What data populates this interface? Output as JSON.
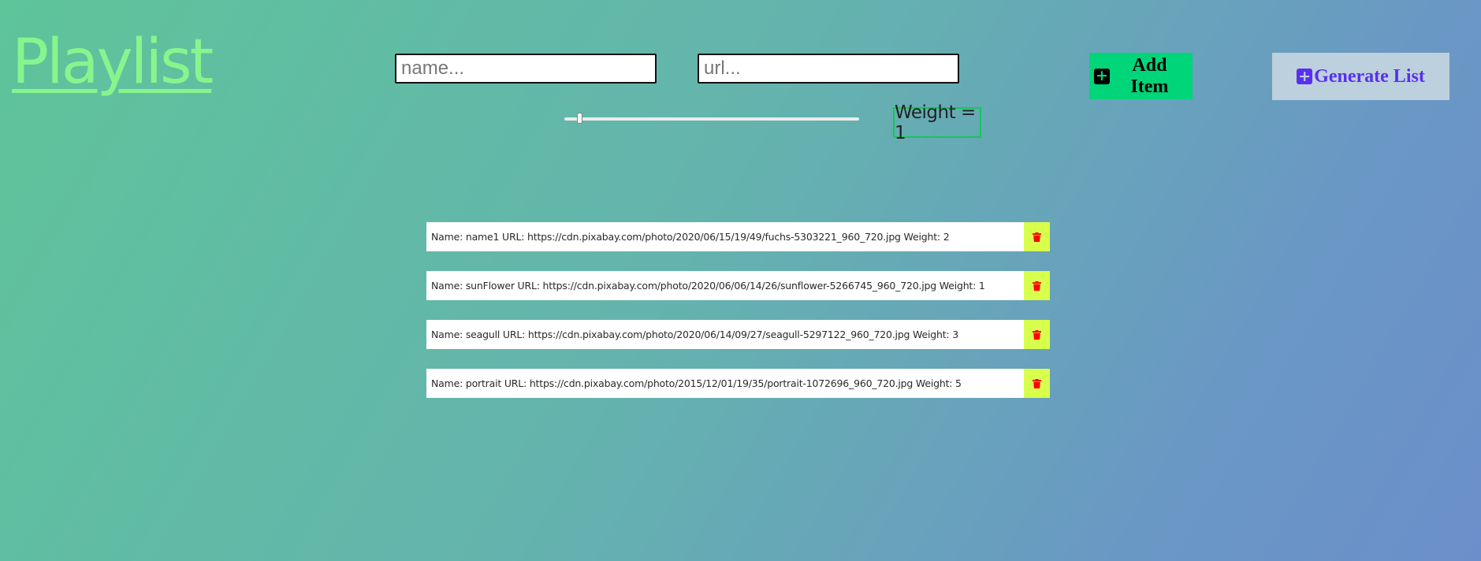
{
  "header": {
    "title": "Playlist"
  },
  "form": {
    "name_placeholder": "name...",
    "url_placeholder": "url...",
    "add_label": "Add Item",
    "generate_label": "Generate List",
    "weight_text": "Weight = 1",
    "weight_value": 1,
    "weight_slider_fraction": 0.05
  },
  "items": [
    {
      "text": "Name: name1 URL: https://cdn.pixabay.com/photo/2020/06/15/19/49/fuchs-5303221_960_720.jpg Weight: 2"
    },
    {
      "text": "Name: sunFlower URL: https://cdn.pixabay.com/photo/2020/06/06/14/26/sunflower-5266745_960_720.jpg Weight: 1"
    },
    {
      "text": "Name: seagull URL: https://cdn.pixabay.com/photo/2020/06/14/09/27/seagull-5297122_960_720.jpg Weight: 3"
    },
    {
      "text": "Name: portrait URL: https://cdn.pixabay.com/photo/2015/12/01/19/35/portrait-1072696_960_720.jpg Weight: 5"
    }
  ],
  "icons": {
    "add": "plus-square-icon",
    "generate": "plus-square-icon",
    "delete": "trash-icon"
  },
  "colors": {
    "title": "#86f58d",
    "add_button_bg": "#00d579",
    "generate_button_bg": "#bcd1dd",
    "generate_button_text": "#5a2ff0",
    "delete_button_bg": "#d7ff4c",
    "trash_icon": "#ff0000",
    "weight_border": "#13c856"
  }
}
